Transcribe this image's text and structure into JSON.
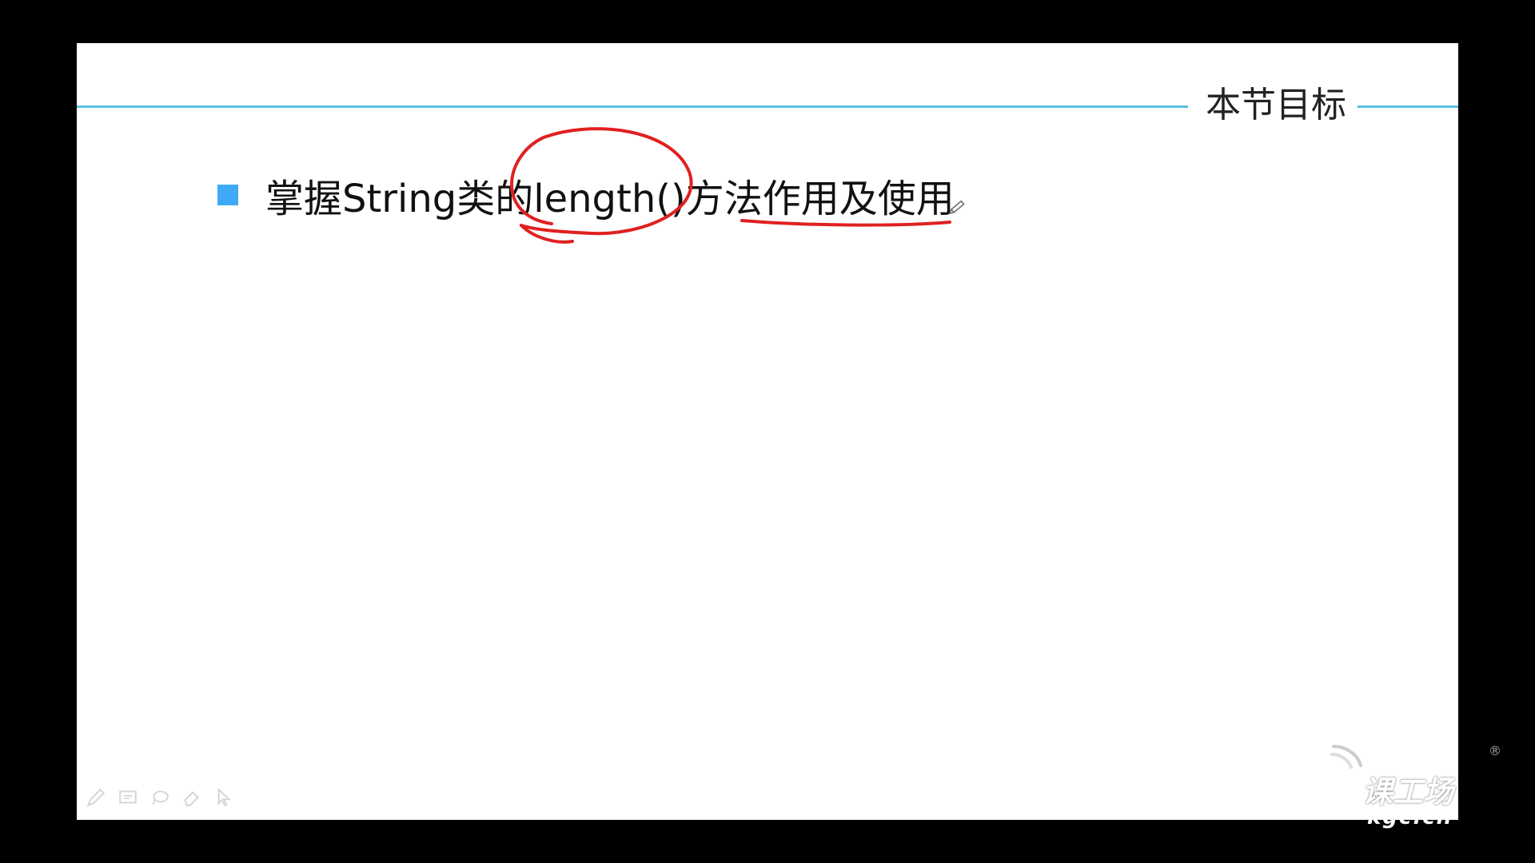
{
  "slide": {
    "section_title": "本节目标",
    "bullets": [
      {
        "text": "掌握String类的length()方法作用及使用"
      }
    ]
  },
  "toolbar": {
    "tools": [
      {
        "icon": "pen-icon"
      },
      {
        "icon": "screen-icon"
      },
      {
        "icon": "lasso-icon"
      },
      {
        "icon": "eraser-icon"
      },
      {
        "icon": "pointer-icon"
      }
    ]
  },
  "logo": {
    "name": "课工场",
    "domain": "kgc.cn",
    "registered_mark": "®"
  },
  "colors": {
    "background": "#000000",
    "slide": "#ffffff",
    "title_line": "#5bc0de",
    "bullet": "#3fa9f5",
    "annotation": "#e02020"
  }
}
